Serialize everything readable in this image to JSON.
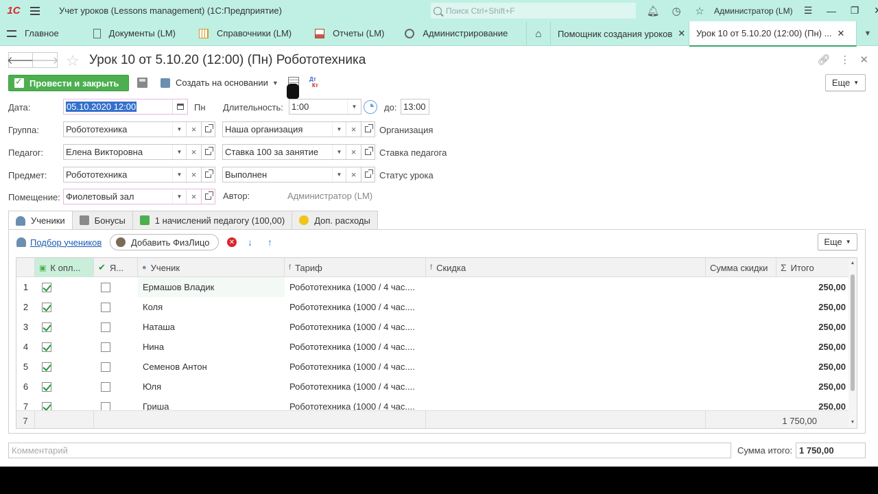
{
  "titlebar": {
    "logo": "1C",
    "title": "Учет уроков (Lessons management)  (1С:Предприятие)",
    "search_placeholder": "Поиск Ctrl+Shift+F",
    "user": "Администратор (LM)"
  },
  "sections": [
    {
      "label": "Главное",
      "icon": "menu-icon"
    },
    {
      "label": "Документы (LM)",
      "icon": "document-icon"
    },
    {
      "label": "Справочники (LM)",
      "icon": "catalog-icon"
    },
    {
      "label": "Отчеты (LM)",
      "icon": "report-icon"
    },
    {
      "label": "Администрирование",
      "icon": "gear-icon"
    }
  ],
  "open_tabs": [
    {
      "label": "Помощник создания уроков",
      "close": "✕"
    },
    {
      "label": "Урок 10 от 5.10.20 (12:00) (Пн) ...",
      "close": "✕"
    }
  ],
  "form": {
    "title": "Урок 10 от 5.10.20 (12:00) (Пн) Робототехника",
    "post_close": "Провести и закрыть",
    "create_based": "Создать на основании",
    "more": "Еще",
    "dt": "Дт",
    "kt": "Кт"
  },
  "fields": {
    "date_label": "Дата:",
    "date_value": "05.10.2020 12:00",
    "weekday": "Пн",
    "duration_label": "Длительность:",
    "duration_value": "1:00",
    "to_label": "до:",
    "to_value": "13:00",
    "group_label": "Группа:",
    "group_value": "Робототехника",
    "org_value": "Наша организация",
    "org_label": "Организация",
    "teacher_label": "Педагог:",
    "teacher_value": "Елена Викторовна",
    "rate_value": "Ставка 100 за занятие",
    "rate_label": "Ставка педагога",
    "subject_label": "Предмет:",
    "subject_value": "Робототехника",
    "status_value": "Выполнен",
    "status_label": "Статус урока",
    "room_label": "Помещение:",
    "room_value": "Фиолетовый зал",
    "author_label": "Автор:",
    "author_value": "Администратор (LM)"
  },
  "tabs": [
    {
      "label": "Ученики",
      "color": "#6a8fb0"
    },
    {
      "label": "Бонусы",
      "color": "#8a8a8a"
    },
    {
      "label": "1 начислений педагогу (100,00)",
      "color": "#4caf50"
    },
    {
      "label": "Доп. расходы",
      "color": "#f0c419"
    }
  ],
  "students_toolbar": {
    "pick": "Подбор учеников",
    "add_person": "Добавить ФизЛицо",
    "more": "Еще"
  },
  "grid": {
    "headers": [
      "К опл...",
      "Я...",
      "Ученик",
      "Тариф",
      "Скидка",
      "Сумма скидки",
      "Итого"
    ],
    "rows": [
      {
        "n": "1",
        "pay": true,
        "ya": false,
        "student": "Ермашов Владик",
        "tariff": "Робототехника (1000 / 4 час....",
        "total": "250,00"
      },
      {
        "n": "2",
        "pay": true,
        "ya": false,
        "student": "Коля",
        "tariff": "Робототехника (1000 / 4 час....",
        "total": "250,00"
      },
      {
        "n": "3",
        "pay": true,
        "ya": false,
        "student": "Наташа",
        "tariff": "Робототехника (1000 / 4 час....",
        "total": "250,00"
      },
      {
        "n": "4",
        "pay": true,
        "ya": false,
        "student": "Нина",
        "tariff": "Робототехника (1000 / 4 час....",
        "total": "250,00"
      },
      {
        "n": "5",
        "pay": true,
        "ya": false,
        "student": "Семенов Антон",
        "tariff": "Робототехника (1000 / 4 час....",
        "total": "250,00"
      },
      {
        "n": "6",
        "pay": true,
        "ya": false,
        "student": "Юля",
        "tariff": "Робототехника (1000 / 4 час....",
        "total": "250,00"
      },
      {
        "n": "7",
        "pay": true,
        "ya": false,
        "student": "Гриша",
        "tariff": "Робототехника (1000 / 4 час....",
        "total": "250,00"
      }
    ],
    "footer_count": "7",
    "footer_total": "1 750,00"
  },
  "footer": {
    "comment_placeholder": "Комментарий",
    "sum_label": "Сумма итого:",
    "sum_value": "1 750,00"
  }
}
